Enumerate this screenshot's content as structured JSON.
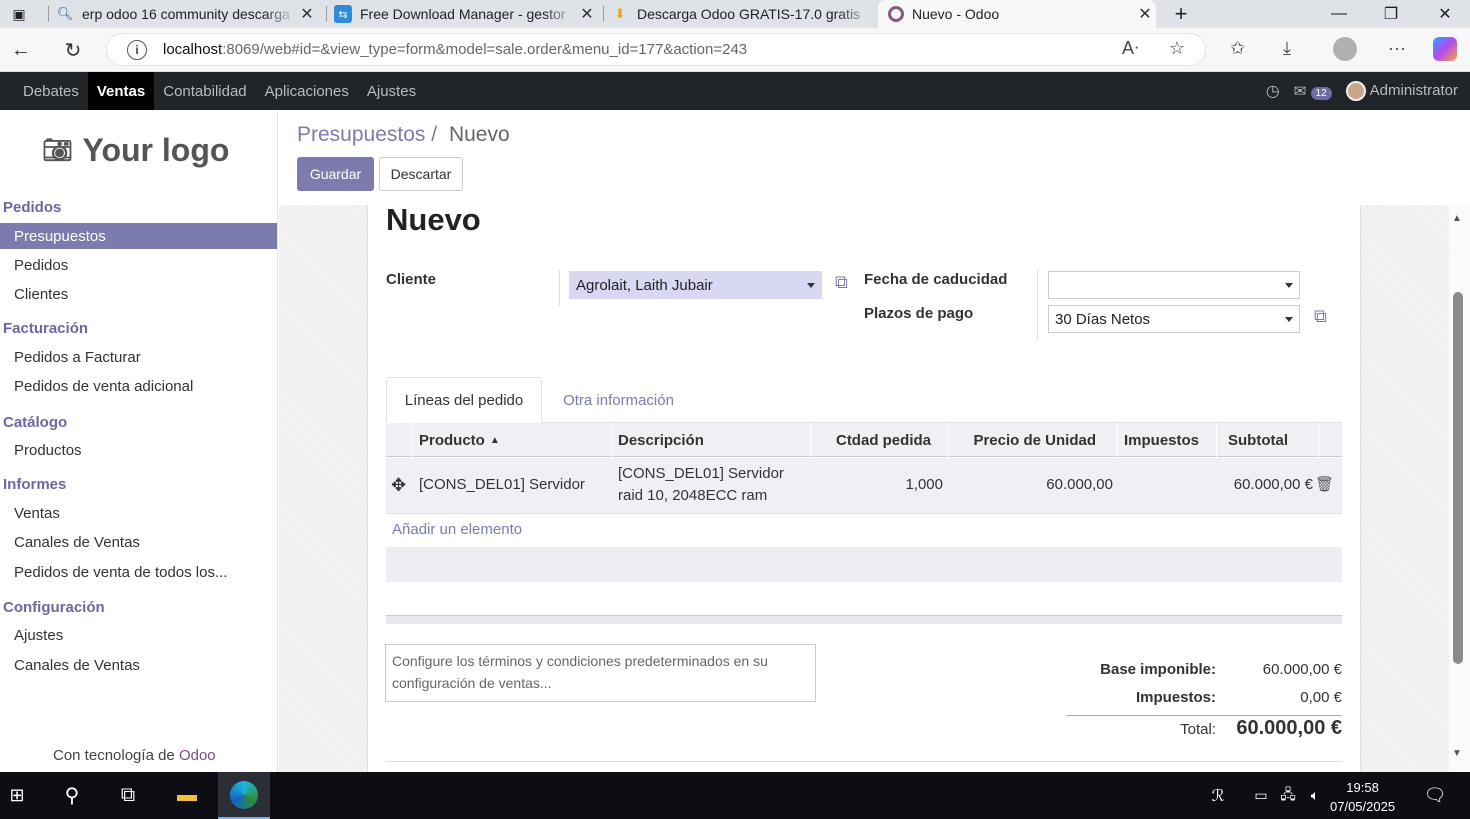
{
  "browser": {
    "tabs": [
      {
        "title": "erp odoo 16 community descarga",
        "icon": "search-icon"
      },
      {
        "title": "Free Download Manager - gestor",
        "icon": "fdm-icon"
      },
      {
        "title": "Descarga Odoo GRATIS-17.0 gratis",
        "icon": "download-site-icon"
      },
      {
        "title": "Nuevo - Odoo",
        "icon": "odoo-icon"
      }
    ],
    "url_host": "localhost",
    "url_rest": ":8069/web#id=&view_type=form&model=sale.order&menu_id=177&action=243"
  },
  "navbar": {
    "menus": [
      "Debates",
      "Ventas",
      "Contabilidad",
      "Aplicaciones",
      "Ajustes"
    ],
    "active_menu": "Ventas",
    "message_count": "12",
    "user": "Administrator"
  },
  "sidebar": {
    "logo_text": "Your logo",
    "sections": [
      {
        "title": "Pedidos",
        "items": [
          "Presupuestos",
          "Pedidos",
          "Clientes"
        ]
      },
      {
        "title": "Facturación",
        "items": [
          "Pedidos a Facturar",
          "Pedidos de venta adicional"
        ]
      },
      {
        "title": "Catálogo",
        "items": [
          "Productos"
        ]
      },
      {
        "title": "Informes",
        "items": [
          "Ventas",
          "Canales de Ventas",
          "Pedidos de venta de todos los..."
        ]
      },
      {
        "title": "Configuración",
        "items": [
          "Ajustes",
          "Canales de Ventas"
        ]
      }
    ],
    "active_item": "Presupuestos",
    "powered_prefix": "Con tecnología de ",
    "powered_brand": "Odoo"
  },
  "control": {
    "breadcrumb_parent": "Presupuestos",
    "breadcrumb_sep": "/",
    "breadcrumb_current": "Nuevo",
    "save_label": "Guardar",
    "discard_label": "Descartar"
  },
  "form": {
    "title": "Nuevo",
    "customer_label": "Cliente",
    "customer_value": "Agrolait, Laith Jubair",
    "expiration_label": "Fecha de caducidad",
    "expiration_value": "",
    "payment_terms_label": "Plazos de pago",
    "payment_terms_value": "30 Días Netos",
    "tabs": [
      "Líneas del pedido",
      "Otra información"
    ],
    "columns": [
      "Producto",
      "Descripción",
      "Ctdad pedida",
      "Precio de Unidad",
      "Impuestos",
      "Subtotal"
    ],
    "lines": [
      {
        "product": "[CONS_DEL01] Servidor",
        "description_1": "[CONS_DEL01] Servidor",
        "description_2": "raid 10, 2048ECC ram",
        "quantity": "1,000",
        "unit_price": "60.000,00",
        "taxes": "",
        "subtotal": "60.000,00 €"
      }
    ],
    "add_line": "Añadir un elemento",
    "terms_placeholder": "Configure los términos y condiciones predeterminados en su configuración de ventas...",
    "untaxed_label": "Base imponible:",
    "untaxed_value": "60.000,00 €",
    "taxes_label": "Impuestos:",
    "taxes_value": "0,00 €",
    "total_label": "Total:",
    "total_value": "60.000,00 €"
  },
  "taskbar": {
    "time": "19:58",
    "date": "07/05/2025"
  }
}
